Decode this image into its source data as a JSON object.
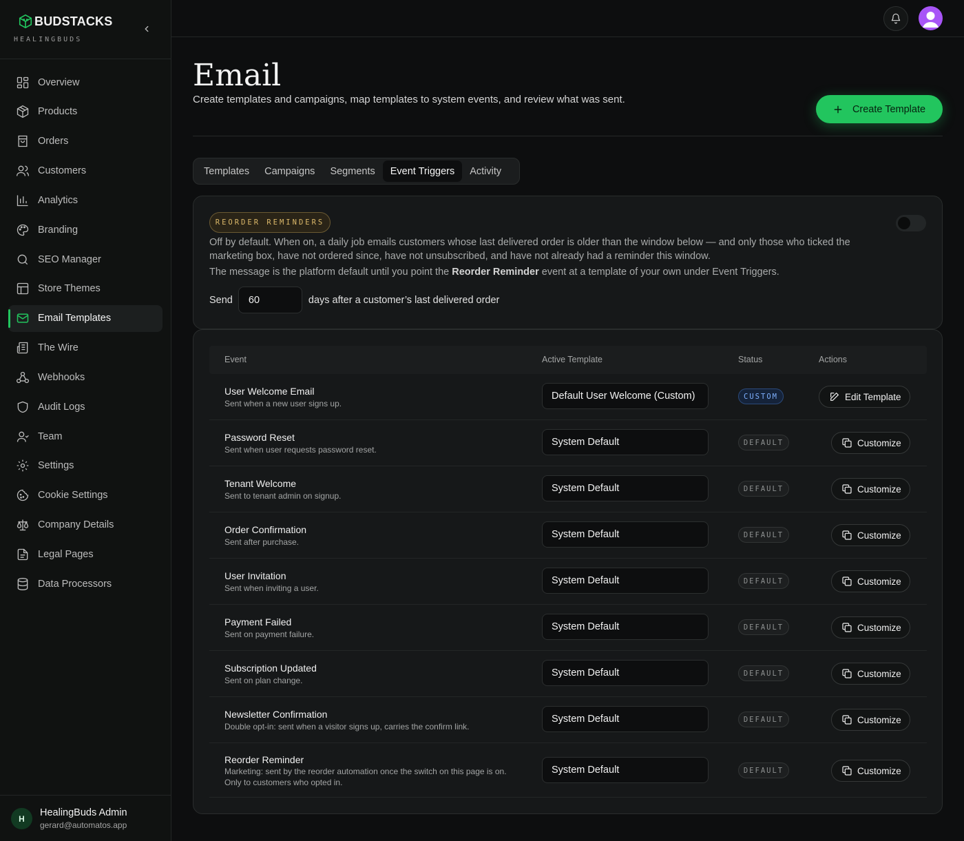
{
  "brand": {
    "name": "BUDSTACKS",
    "sub": "HEALINGBUDS"
  },
  "sidebar": {
    "items": [
      {
        "label": "Overview",
        "icon": "grid-icon"
      },
      {
        "label": "Products",
        "icon": "package-icon"
      },
      {
        "label": "Orders",
        "icon": "shopping-bag-icon"
      },
      {
        "label": "Customers",
        "icon": "users-icon"
      },
      {
        "label": "Analytics",
        "icon": "bar-chart-icon"
      },
      {
        "label": "Branding",
        "icon": "palette-icon"
      },
      {
        "label": "SEO Manager",
        "icon": "search-icon"
      },
      {
        "label": "Store Themes",
        "icon": "layout-icon"
      },
      {
        "label": "Email Templates",
        "icon": "mail-icon",
        "active": true
      },
      {
        "label": "The Wire",
        "icon": "newspaper-icon"
      },
      {
        "label": "Webhooks",
        "icon": "webhook-icon"
      },
      {
        "label": "Audit Logs",
        "icon": "shield-icon"
      },
      {
        "label": "Team",
        "icon": "user-icon"
      },
      {
        "label": "Settings",
        "icon": "gear-icon"
      },
      {
        "label": "Cookie Settings",
        "icon": "cookie-icon"
      },
      {
        "label": "Company Details",
        "icon": "scale-icon"
      },
      {
        "label": "Legal Pages",
        "icon": "file-text-icon"
      },
      {
        "label": "Data Processors",
        "icon": "database-icon"
      }
    ]
  },
  "user": {
    "initial": "H",
    "name": "HealingBuds Admin",
    "email": "gerard@automatos.app"
  },
  "header": {
    "title": "Email",
    "description": "Create templates and campaigns, map templates to system events, and review what was sent.",
    "create_label": "Create Template"
  },
  "tabs": [
    {
      "label": "Templates"
    },
    {
      "label": "Campaigns"
    },
    {
      "label": "Segments"
    },
    {
      "label": "Event Triggers",
      "active": true
    },
    {
      "label": "Activity"
    }
  ],
  "reminder": {
    "badge": "REORDER REMINDERS",
    "enabled": false,
    "desc1": "Off by default. When on, a daily job emails customers whose last delivered order is older than the window below — and only those who ticked the marketing box, have not ordered since, have not unsubscribed, and have not already had a reminder this window.",
    "desc2_a": "The message is the platform default until you point the ",
    "desc2_b": "Reorder Reminder",
    "desc2_c": " event at a template of your own under Event Triggers.",
    "send_label": "Send",
    "days_value": "60",
    "days_suffix": "days after a customer’s last delivered order"
  },
  "table": {
    "headers": {
      "event": "Event",
      "template": "Active Template",
      "status": "Status",
      "actions": "Actions"
    },
    "rows": [
      {
        "name": "User Welcome Email",
        "desc": "Sent when a new user signs up.",
        "template": "Default User Welcome (Custom)",
        "status": "CUSTOM",
        "action": "Edit Template"
      },
      {
        "name": "Password Reset",
        "desc": "Sent when user requests password reset.",
        "template": "System Default",
        "status": "DEFAULT",
        "action": "Customize"
      },
      {
        "name": "Tenant Welcome",
        "desc": "Sent to tenant admin on signup.",
        "template": "System Default",
        "status": "DEFAULT",
        "action": "Customize"
      },
      {
        "name": "Order Confirmation",
        "desc": "Sent after purchase.",
        "template": "System Default",
        "status": "DEFAULT",
        "action": "Customize"
      },
      {
        "name": "User Invitation",
        "desc": "Sent when inviting a user.",
        "template": "System Default",
        "status": "DEFAULT",
        "action": "Customize"
      },
      {
        "name": "Payment Failed",
        "desc": "Sent on payment failure.",
        "template": "System Default",
        "status": "DEFAULT",
        "action": "Customize"
      },
      {
        "name": "Subscription Updated",
        "desc": "Sent on plan change.",
        "template": "System Default",
        "status": "DEFAULT",
        "action": "Customize"
      },
      {
        "name": "Newsletter Confirmation",
        "desc": "Double opt-in: sent when a visitor signs up, carries the confirm link.",
        "template": "System Default",
        "status": "DEFAULT",
        "action": "Customize"
      },
      {
        "name": "Reorder Reminder",
        "desc": "Marketing: sent by the reorder automation once the switch on this page is on. Only to customers who opted in.",
        "template": "System Default",
        "status": "DEFAULT",
        "action": "Customize"
      }
    ]
  },
  "colors": {
    "accent": "#22c55e",
    "background": "#0d0e0f",
    "profile": "#a855f7"
  }
}
